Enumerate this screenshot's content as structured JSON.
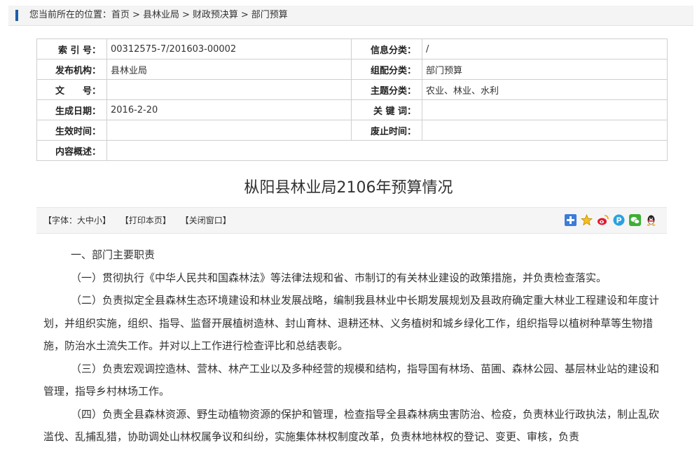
{
  "breadcrumb": {
    "prefix": "您当前所在的位置：",
    "items": [
      "首页",
      "县林业局",
      "财政预决算",
      "部门预算"
    ],
    "separator": ">"
  },
  "meta": {
    "rows": [
      {
        "l1": "索 引 号：",
        "v1": "00312575-7/201603-00002",
        "l2": "信息分类：",
        "v2": "/"
      },
      {
        "l1": "发布机构：",
        "v1": "县林业局",
        "l2": "组配分类：",
        "v2": "部门预算"
      },
      {
        "l1": "文　　号：",
        "v1": "",
        "l2": "主题分类：",
        "v2": "农业、林业、水利"
      },
      {
        "l1": "生成日期：",
        "v1": "2016-2-20",
        "l2": "关 键 词：",
        "v2": ""
      },
      {
        "l1": "生效时间：",
        "v1": "",
        "l2": "废止时间：",
        "v2": ""
      }
    ],
    "summary_label": "内容概述：",
    "summary_value": ""
  },
  "title": "枞阳县林业局2106年预算情况",
  "toolbar": {
    "font_size": "【字体：大中小】",
    "print": "【打印本页】",
    "close": "【关闭窗口】"
  },
  "share_icons": [
    "plus-share-icon",
    "star-favorite-icon",
    "weibo-icon",
    "pinterest-icon",
    "wechat-icon",
    "qq-icon"
  ],
  "content": {
    "heading": "一、部门主要职责",
    "paragraphs": [
      "（一）贯彻执行《中华人民共和国森林法》等法律法规和省、市制订的有关林业建设的政策措施，并负责检查落实。",
      "（二）负责拟定全县森林生态环境建设和林业发展战略，编制我县林业中长期发展规划及县政府确定重大林业工程建设和年度计划，并组织实施，组织、指导、监督开展植树造林、封山育林、退耕还林、义务植树和城乡绿化工作，组织指导以植树种草等生物措施，防治水土流失工作。并对以上工作进行检查评比和总结表彰。",
      "（三）负责宏观调控造林、营林、林产工业以及多种经营的规模和结构，指导国有林场、苗圃、森林公园、基层林业站的建设和管理，指导乡村林场工作。",
      "（四）负责全县森林资源、野生动植物资源的保护和管理，检查指导全县森林病虫害防治、检疫，负责林业行政执法，制止乱砍滥伐、乱捕乱猎，协助调处山林权属争议和纠纷，实施集体林权制度改革，负责林地林权的登记、变更、审核，负责"
    ]
  }
}
